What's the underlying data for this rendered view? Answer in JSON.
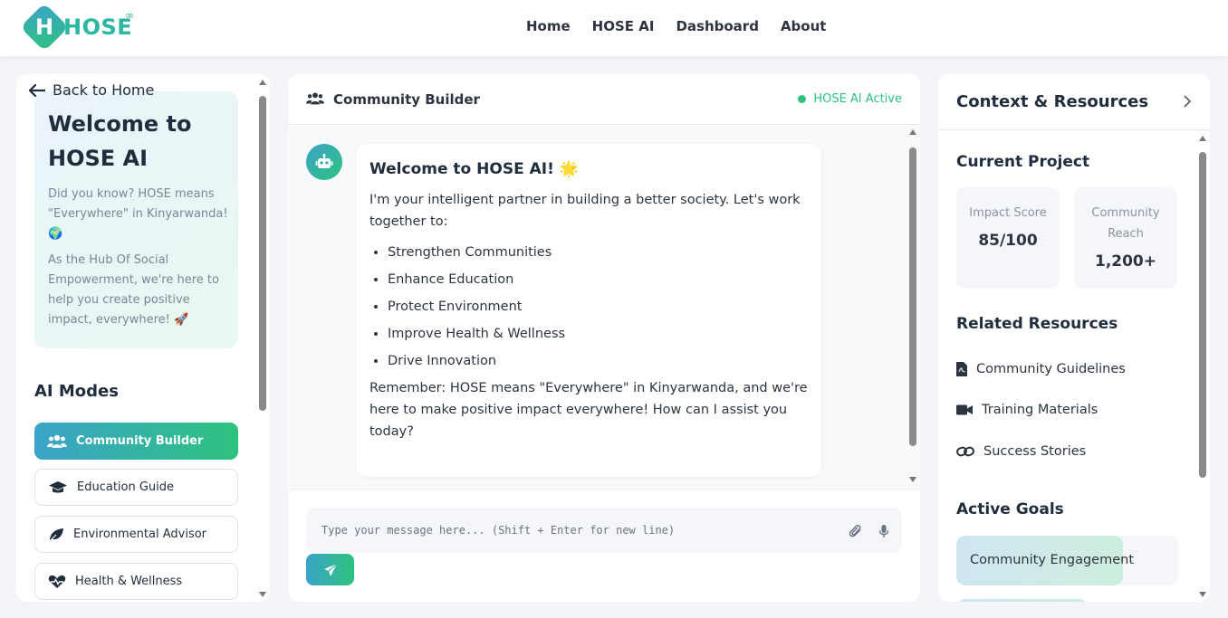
{
  "brand": {
    "name": "HOSE",
    "mark": "H",
    "superscript": "∞"
  },
  "nav": {
    "items": [
      "Home",
      "HOSE AI",
      "Dashboard",
      "About"
    ]
  },
  "sidebar": {
    "back_label": "Back to Home",
    "welcome_title": "Welcome to HOSE AI",
    "welcome_p1": "Did you know? HOSE means \"Everywhere\" in Kinyarwanda! 🌍",
    "welcome_p2": "As the Hub Of Social Empowerment, we're here to help you create positive impact, everywhere! 🚀",
    "modes_title": "AI Modes",
    "modes": [
      {
        "label": "Community Builder",
        "icon": "users-icon",
        "active": true
      },
      {
        "label": "Education Guide",
        "icon": "graduation-cap-icon",
        "active": false
      },
      {
        "label": "Environmental Advisor",
        "icon": "leaf-icon",
        "active": false
      },
      {
        "label": "Health & Wellness",
        "icon": "heart-pulse-icon",
        "active": false
      }
    ]
  },
  "chat": {
    "header_title": "Community Builder",
    "status": "HOSE AI Active",
    "message": {
      "title": "Welcome to HOSE AI! 🌟",
      "intro": "I'm your intelligent partner in building a better society. Let's work together to:",
      "items": [
        "Strengthen Communities",
        "Enhance Education",
        "Protect Environment",
        "Improve Health & Wellness",
        "Drive Innovation"
      ],
      "outro": "Remember: HOSE means \"Everywhere\" in Kinyarwanda, and we're here to make positive impact everywhere! How can I assist you today?"
    },
    "input_placeholder": "Type your message here... (Shift + Enter for new line)"
  },
  "context": {
    "title": "Context & Resources",
    "project_title": "Current Project",
    "metrics": [
      {
        "label": "Impact Score",
        "value": "85/100"
      },
      {
        "label": "Community Reach",
        "value": "1,200+"
      }
    ],
    "resources_title": "Related Resources",
    "resources": [
      {
        "label": "Community Guidelines",
        "icon": "file-pdf-icon"
      },
      {
        "label": "Training Materials",
        "icon": "video-icon"
      },
      {
        "label": "Success Stories",
        "icon": "link-icon"
      }
    ],
    "goals_title": "Active Goals",
    "goals": [
      {
        "label": "Community Engagement",
        "progress": 0.75
      },
      {
        "label": "",
        "progress": 0.6
      }
    ]
  },
  "colors": {
    "accent_start": "#3ba3c9",
    "accent_end": "#2ec27e",
    "status": "#2ec27e"
  }
}
